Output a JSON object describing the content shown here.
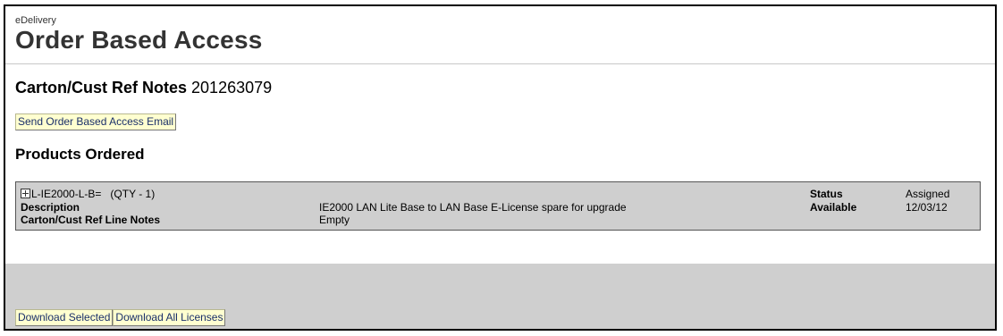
{
  "header": {
    "app_label": "eDelivery",
    "title": "Order Based Access"
  },
  "ref": {
    "label": "Carton/Cust Ref Notes",
    "value": "201263079"
  },
  "actions": {
    "send_email": "Send Order Based Access Email"
  },
  "products": {
    "heading": "Products Ordered",
    "items": [
      {
        "sku": "L-IE2000-L-B=",
        "qty": "(QTY - 1)",
        "description_label": "Description",
        "description": "IE2000 LAN Lite Base to LAN Base E-License spare for upgrade",
        "line_notes_label": "Carton/Cust Ref Line Notes",
        "line_notes": "Empty",
        "status_label": "Status",
        "status": "Assigned",
        "available_label": "Available",
        "available": "12/03/12"
      }
    ]
  },
  "footer": {
    "download_selected": "Download Selected",
    "download_all": "Download All Licenses"
  }
}
